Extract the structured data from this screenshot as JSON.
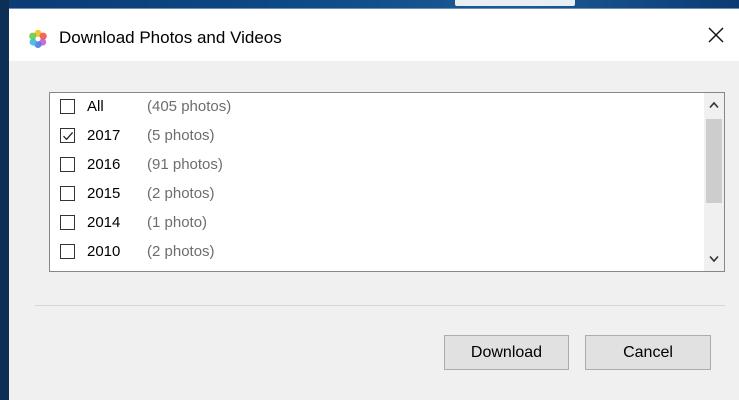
{
  "window": {
    "title": "Download Photos and Videos",
    "app_icon": "photos-app-icon",
    "close_icon": "close-icon"
  },
  "list": {
    "items": [
      {
        "name": "All",
        "count": "(405 photos)",
        "checked": false
      },
      {
        "name": "2017",
        "count": "(5 photos)",
        "checked": true
      },
      {
        "name": "2016",
        "count": "(91 photos)",
        "checked": false
      },
      {
        "name": "2015",
        "count": "(2 photos)",
        "checked": false
      },
      {
        "name": "2014",
        "count": "(1 photo)",
        "checked": false
      },
      {
        "name": "2010",
        "count": "(2 photos)",
        "checked": false
      }
    ]
  },
  "buttons": {
    "download_label": "Download",
    "cancel_label": "Cancel"
  },
  "colors": {
    "dialog_bg": "#f0f0f0",
    "titlebar_bg": "#ffffff",
    "secondary_text": "#6d6d6d",
    "button_bg": "#e1e1e1"
  }
}
